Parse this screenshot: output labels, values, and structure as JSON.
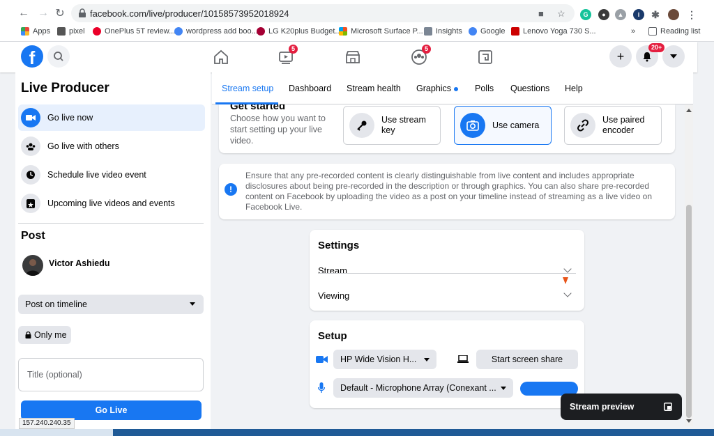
{
  "browser": {
    "url": "facebook.com/live/producer/10158573952018924",
    "bookmarks": [
      {
        "label": "Apps",
        "color": "#e8453c"
      },
      {
        "label": "pixel",
        "color": "#555555"
      },
      {
        "label": "OnePlus 5T review...",
        "color": "#eb0029"
      },
      {
        "label": "wordpress add boo...",
        "color": "#4285f4"
      },
      {
        "label": "LG K20plus Budget...",
        "color": "#a50034"
      },
      {
        "label": "Microsoft Surface P...",
        "color": "#00a4ef"
      },
      {
        "label": "Insights",
        "color": "#7b8694"
      },
      {
        "label": "Google",
        "color": "#4285f4"
      },
      {
        "label": "Lenovo Yoga 730 S...",
        "color": "#cc0000"
      }
    ],
    "more_glyph": "»",
    "reading_list": "Reading list"
  },
  "fb_header": {
    "logo": "f",
    "watch_badge": "5",
    "groups_badge": "5",
    "notif_badge": "20+"
  },
  "sidebar": {
    "title": "Live Producer",
    "items": [
      {
        "label": "Go live now",
        "icon": "video-camera-icon"
      },
      {
        "label": "Go live with others",
        "icon": "group-icon"
      },
      {
        "label": "Schedule live video event",
        "icon": "clock-icon"
      },
      {
        "label": "Upcoming live videos and events",
        "icon": "calendar-star-icon"
      }
    ],
    "post_heading": "Post",
    "user_name": "Victor Ashiedu",
    "post_target": "Post on timeline",
    "privacy": "Only me",
    "title_placeholder": "Title (optional)",
    "go_live": "Go Live",
    "status_url": "157.240.240.35"
  },
  "tabs": [
    {
      "label": "Stream setup",
      "active": true
    },
    {
      "label": "Dashboard"
    },
    {
      "label": "Stream health"
    },
    {
      "label": "Graphics",
      "dot": true
    },
    {
      "label": "Polls"
    },
    {
      "label": "Questions"
    },
    {
      "label": "Help"
    }
  ],
  "get_started": {
    "title": "Get started",
    "description": "Choose how you want to start setting up your live video.",
    "options": [
      {
        "label": "Use stream key",
        "icon": "key-icon"
      },
      {
        "label": "Use camera",
        "icon": "camera-icon",
        "selected": true
      },
      {
        "label": "Use paired encoder",
        "icon": "link-icon"
      }
    ]
  },
  "notice": {
    "text": "Ensure that any pre-recorded content is clearly distinguishable from live content and includes appropriate disclosures about being pre-recorded in the description or through graphics. You can also share pre-recorded content on Facebook by uploading the video as a post on your timeline instead of streaming as a live video on Facebook Live."
  },
  "settings": {
    "title": "Settings",
    "rows": [
      "Stream",
      "Viewing"
    ]
  },
  "setup": {
    "title": "Setup",
    "camera": "HP Wide Vision H...",
    "screen_share": "Start screen share",
    "microphone": "Default - Microphone Array (Conexant ..."
  },
  "stream_preview": "Stream preview",
  "colors": {
    "accent": "#1877f2",
    "badge": "#e41e3f"
  }
}
